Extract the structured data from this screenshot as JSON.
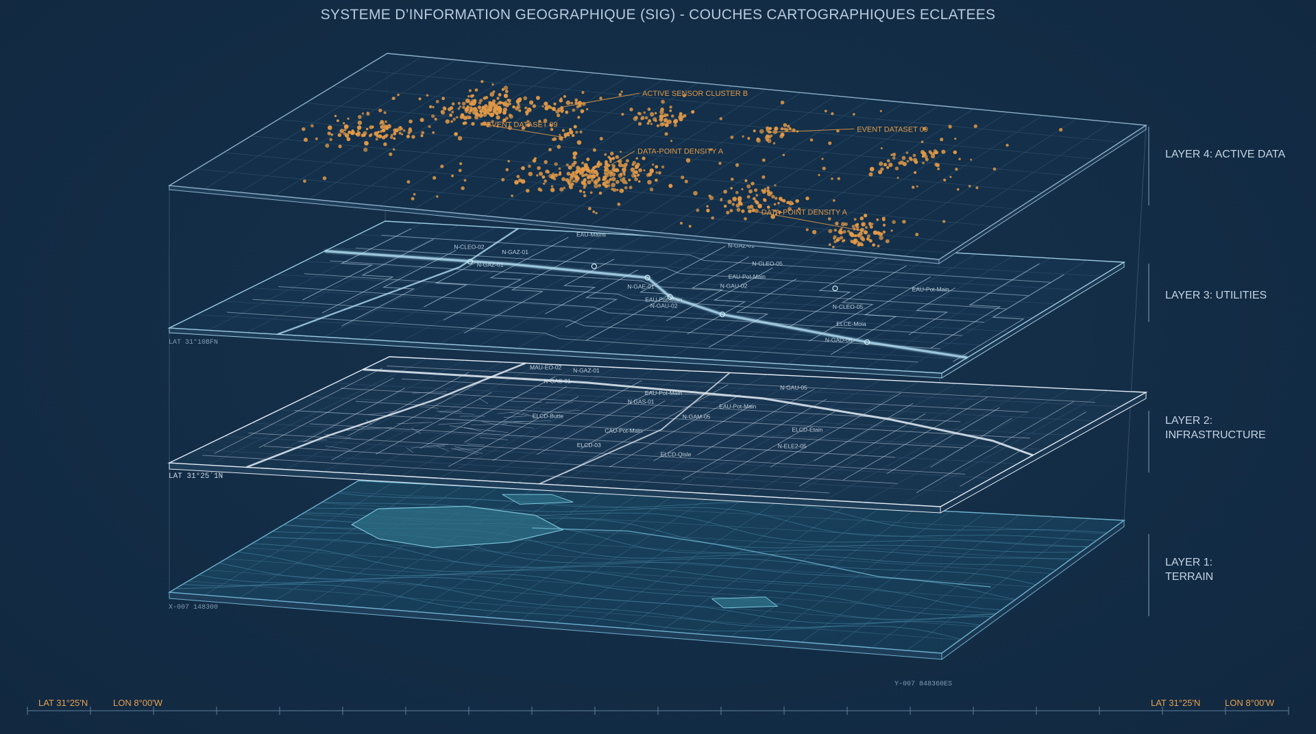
{
  "title": "SYSTEME D’INFORMATION GEOGRAPHIQUE (SIG) - COUCHES CARTOGRAPHIQUES ECLATEES",
  "colors": {
    "background": "#132c45",
    "grid": "#3c6282",
    "data_point": "#e39a47",
    "utility_line": "#a9d5ea",
    "infrastructure_line": "#e6eef6",
    "terrain_water": "#2d6f86",
    "label_text": "#c4d4e3",
    "accent_coord": "#e7a24f"
  },
  "layers": [
    {
      "id": "layer4",
      "label_lines": [
        "LAYER 4: ACTIVE DATA"
      ]
    },
    {
      "id": "layer3",
      "label_lines": [
        "LAYER 3: UTILITIES"
      ]
    },
    {
      "id": "layer2",
      "label_lines": [
        "LAYER 2:",
        "INFRASTRUCTURE"
      ]
    },
    {
      "id": "layer1",
      "label_lines": [
        "LAYER 1:",
        "TERRAIN"
      ]
    }
  ],
  "layer4_annotations": [
    "ACTIVE SENSOR CLUSTER B",
    "EVENT DATASET 09",
    "EVENT DATASET 09",
    "DATA-POINT DENSITY A",
    "DATA-POINT DENSITY A"
  ],
  "layer3_labels": [
    "EAU-Mains",
    "N-GAZ-01",
    "N-GAZ-01",
    "N-GAZ-01",
    "EAU-Pot-Main",
    "EAU-Pot-Main",
    "N-GAU-02",
    "N-GAU-02",
    "ELCE-Moia",
    "N-GAD-08",
    "EAU-Pot-Main",
    "N-CLEO-05",
    "N-CLEO-05",
    "N-GAE-01",
    "N-CLEO-02"
  ],
  "layer2_labels": [
    "N-GAZ-01",
    "N-GAS-01",
    "N-GAU-05",
    "EAU-Pot-Main",
    "N GAS-01",
    "EAU-Pot-Main",
    "N-GAM-05",
    "N-ELE2-05",
    "ELCD-Etain",
    "CAU-Pot-Main",
    "ELCD-Qisle",
    "ELCD-03",
    "MAU-EO-02",
    "ELCD-Butte"
  ],
  "side_codes": {
    "layer3_left": "LAT 31°10BFN",
    "layer2_left": "LAT 31°25´1N",
    "layer1_left": "X-007 148300",
    "layer1_bottom": "Y-007 848360ES"
  },
  "footer": {
    "left_lat": "LAT 31°25'N",
    "left_lon": "LON 8°00'W",
    "right_lat": "LAT 31°25'N",
    "right_lon": "LON 8°00'W"
  }
}
